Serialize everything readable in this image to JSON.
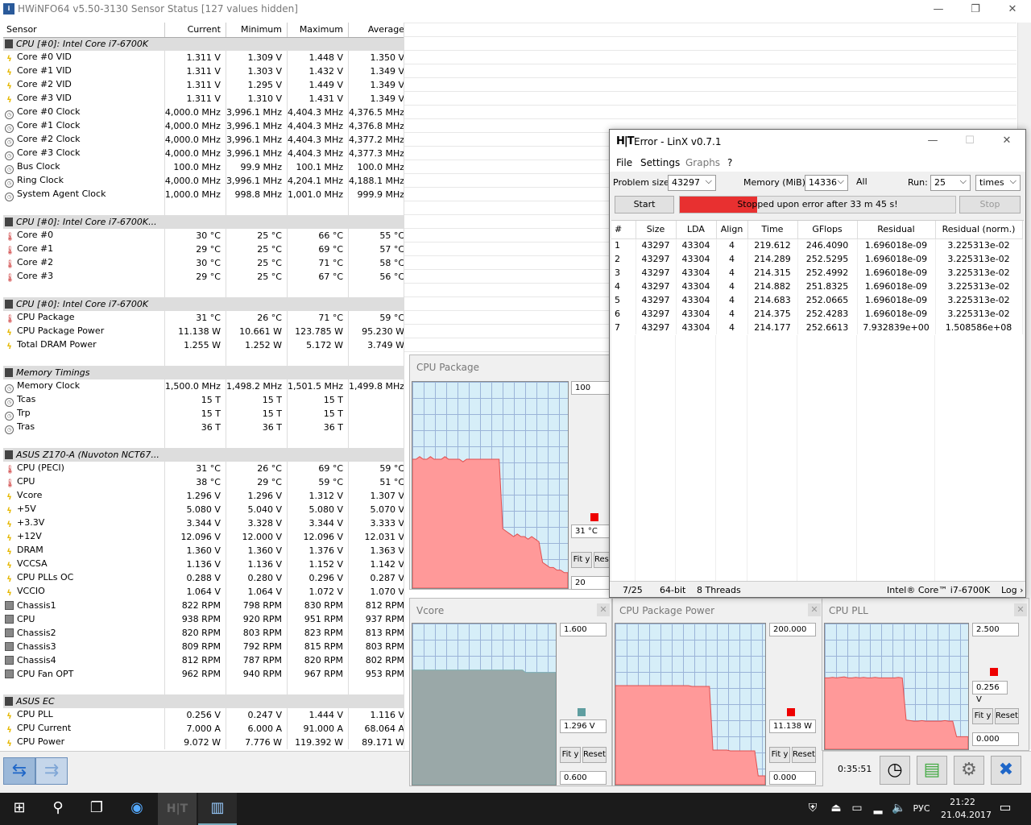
{
  "hwinfo": {
    "title": "HWiNFO64 v5.50-3130 Sensor Status [127 values hidden]",
    "columns": [
      "Sensor",
      "Current",
      "Minimum",
      "Maximum",
      "Average"
    ],
    "rows": [
      {
        "type": "group",
        "name": "CPU [#0]: Intel Core i7-6700K",
        "icon": "chip-icon"
      },
      {
        "icon": "volt",
        "name": "Core #0 VID",
        "cur": "1.311 V",
        "min": "1.309 V",
        "max": "1.448 V",
        "avg": "1.350 V"
      },
      {
        "icon": "volt",
        "name": "Core #1 VID",
        "cur": "1.311 V",
        "min": "1.303 V",
        "max": "1.432 V",
        "avg": "1.349 V"
      },
      {
        "icon": "volt",
        "name": "Core #2 VID",
        "cur": "1.311 V",
        "min": "1.295 V",
        "max": "1.449 V",
        "avg": "1.349 V"
      },
      {
        "icon": "volt",
        "name": "Core #3 VID",
        "cur": "1.311 V",
        "min": "1.310 V",
        "max": "1.431 V",
        "avg": "1.349 V"
      },
      {
        "icon": "clock",
        "name": "Core #0 Clock",
        "cur": "4,000.0 MHz",
        "min": "3,996.1 MHz",
        "max": "4,404.3 MHz",
        "avg": "4,376.5 MHz"
      },
      {
        "icon": "clock",
        "name": "Core #1 Clock",
        "cur": "4,000.0 MHz",
        "min": "3,996.1 MHz",
        "max": "4,404.3 MHz",
        "avg": "4,376.8 MHz"
      },
      {
        "icon": "clock",
        "name": "Core #2 Clock",
        "cur": "4,000.0 MHz",
        "min": "3,996.1 MHz",
        "max": "4,404.3 MHz",
        "avg": "4,377.2 MHz"
      },
      {
        "icon": "clock",
        "name": "Core #3 Clock",
        "cur": "4,000.0 MHz",
        "min": "3,996.1 MHz",
        "max": "4,404.3 MHz",
        "avg": "4,377.3 MHz"
      },
      {
        "icon": "clock",
        "name": "Bus Clock",
        "cur": "100.0 MHz",
        "min": "99.9 MHz",
        "max": "100.1 MHz",
        "avg": "100.0 MHz"
      },
      {
        "icon": "clock",
        "name": "Ring Clock",
        "cur": "4,000.0 MHz",
        "min": "3,996.1 MHz",
        "max": "4,204.1 MHz",
        "avg": "4,188.1 MHz"
      },
      {
        "icon": "clock",
        "name": "System Agent Clock",
        "cur": "1,000.0 MHz",
        "min": "998.8 MHz",
        "max": "1,001.0 MHz",
        "avg": "999.9 MHz"
      },
      {
        "type": "spacer"
      },
      {
        "type": "group",
        "name": "CPU [#0]: Intel Core i7-6700K...",
        "icon": "chip-icon"
      },
      {
        "icon": "temp",
        "name": "Core #0",
        "cur": "30 °C",
        "min": "25 °C",
        "max": "66 °C",
        "avg": "55 °C"
      },
      {
        "icon": "temp",
        "name": "Core #1",
        "cur": "29 °C",
        "min": "25 °C",
        "max": "69 °C",
        "avg": "57 °C"
      },
      {
        "icon": "temp",
        "name": "Core #2",
        "cur": "30 °C",
        "min": "25 °C",
        "max": "71 °C",
        "avg": "58 °C"
      },
      {
        "icon": "temp",
        "name": "Core #3",
        "cur": "29 °C",
        "min": "25 °C",
        "max": "67 °C",
        "avg": "56 °C"
      },
      {
        "type": "spacer"
      },
      {
        "type": "group",
        "name": "CPU [#0]: Intel Core i7-6700K",
        "icon": "chip-icon"
      },
      {
        "icon": "temp",
        "name": "CPU Package",
        "cur": "31 °C",
        "min": "26 °C",
        "max": "71 °C",
        "avg": "59 °C"
      },
      {
        "icon": "power",
        "name": "CPU Package Power",
        "cur": "11.138 W",
        "min": "10.661 W",
        "max": "123.785 W",
        "avg": "95.230 W"
      },
      {
        "icon": "power",
        "name": "Total DRAM Power",
        "cur": "1.255 W",
        "min": "1.252 W",
        "max": "5.172 W",
        "avg": "3.749 W"
      },
      {
        "type": "spacer"
      },
      {
        "type": "group",
        "name": "Memory Timings",
        "icon": "chip-icon"
      },
      {
        "icon": "clock",
        "name": "Memory Clock",
        "cur": "1,500.0 MHz",
        "min": "1,498.2 MHz",
        "max": "1,501.5 MHz",
        "avg": "1,499.8 MHz"
      },
      {
        "icon": "clock",
        "name": "Tcas",
        "cur": "15 T",
        "min": "15 T",
        "max": "15 T",
        "avg": ""
      },
      {
        "icon": "clock",
        "name": "Trp",
        "cur": "15 T",
        "min": "15 T",
        "max": "15 T",
        "avg": ""
      },
      {
        "icon": "clock",
        "name": "Tras",
        "cur": "36 T",
        "min": "36 T",
        "max": "36 T",
        "avg": ""
      },
      {
        "type": "spacer"
      },
      {
        "type": "group",
        "name": "ASUS Z170-A (Nuvoton NCT67...",
        "icon": "chip-icon"
      },
      {
        "icon": "temp",
        "name": "CPU (PECI)",
        "cur": "31 °C",
        "min": "26 °C",
        "max": "69 °C",
        "avg": "59 °C"
      },
      {
        "icon": "temp",
        "name": "CPU",
        "cur": "38 °C",
        "min": "29 °C",
        "max": "59 °C",
        "avg": "51 °C"
      },
      {
        "icon": "volt",
        "name": "Vcore",
        "cur": "1.296 V",
        "min": "1.296 V",
        "max": "1.312 V",
        "avg": "1.307 V"
      },
      {
        "icon": "volt",
        "name": "+5V",
        "cur": "5.080 V",
        "min": "5.040 V",
        "max": "5.080 V",
        "avg": "5.070 V"
      },
      {
        "icon": "volt",
        "name": "+3.3V",
        "cur": "3.344 V",
        "min": "3.328 V",
        "max": "3.344 V",
        "avg": "3.333 V"
      },
      {
        "icon": "volt",
        "name": "+12V",
        "cur": "12.096 V",
        "min": "12.000 V",
        "max": "12.096 V",
        "avg": "12.031 V"
      },
      {
        "icon": "volt",
        "name": "DRAM",
        "cur": "1.360 V",
        "min": "1.360 V",
        "max": "1.376 V",
        "avg": "1.363 V"
      },
      {
        "icon": "volt",
        "name": "VCCSA",
        "cur": "1.136 V",
        "min": "1.136 V",
        "max": "1.152 V",
        "avg": "1.142 V"
      },
      {
        "icon": "volt",
        "name": "CPU PLLs OC",
        "cur": "0.288 V",
        "min": "0.280 V",
        "max": "0.296 V",
        "avg": "0.287 V"
      },
      {
        "icon": "volt",
        "name": "VCCIO",
        "cur": "1.064 V",
        "min": "1.064 V",
        "max": "1.072 V",
        "avg": "1.070 V"
      },
      {
        "icon": "fan",
        "name": "Chassis1",
        "cur": "822 RPM",
        "min": "798 RPM",
        "max": "830 RPM",
        "avg": "812 RPM"
      },
      {
        "icon": "fan",
        "name": "CPU",
        "cur": "938 RPM",
        "min": "920 RPM",
        "max": "951 RPM",
        "avg": "937 RPM"
      },
      {
        "icon": "fan",
        "name": "Chassis2",
        "cur": "820 RPM",
        "min": "803 RPM",
        "max": "823 RPM",
        "avg": "813 RPM"
      },
      {
        "icon": "fan",
        "name": "Chassis3",
        "cur": "809 RPM",
        "min": "792 RPM",
        "max": "815 RPM",
        "avg": "803 RPM"
      },
      {
        "icon": "fan",
        "name": "Chassis4",
        "cur": "812 RPM",
        "min": "787 RPM",
        "max": "820 RPM",
        "avg": "802 RPM"
      },
      {
        "icon": "fan",
        "name": "CPU Fan OPT",
        "cur": "962 RPM",
        "min": "940 RPM",
        "max": "967 RPM",
        "avg": "953 RPM"
      },
      {
        "type": "spacer"
      },
      {
        "type": "group",
        "name": "ASUS EC",
        "icon": "chip-icon"
      },
      {
        "icon": "volt",
        "name": "CPU PLL",
        "cur": "0.256 V",
        "min": "0.247 V",
        "max": "1.444 V",
        "avg": "1.116 V"
      },
      {
        "icon": "volt",
        "name": "CPU Current",
        "cur": "7.000 A",
        "min": "6.000 A",
        "max": "91.000 A",
        "avg": "68.064 A"
      },
      {
        "icon": "power",
        "name": "CPU Power",
        "cur": "9.072 W",
        "min": "7.776 W",
        "max": "119.392 W",
        "avg": "89.171 W"
      }
    ],
    "timer": "0:35:51"
  },
  "graphs": {
    "cpu_package": {
      "title": "CPU Package",
      "top": "100",
      "current": "31 °C",
      "bottom": "20",
      "fit": "Fit y",
      "reset": "Reset",
      "color": "#ff9999",
      "series": [
        70,
        70,
        71,
        70,
        70,
        71,
        70,
        70,
        70,
        71,
        70,
        70,
        70,
        70,
        69,
        70,
        70,
        70,
        70,
        70,
        70,
        70,
        70,
        70,
        70,
        43,
        42,
        41,
        40,
        41,
        40,
        40,
        39,
        40,
        39,
        38,
        30,
        29,
        28,
        28,
        27,
        27,
        26,
        26
      ]
    },
    "vcore": {
      "title": "Vcore",
      "top": "1.600",
      "current": "1.296 V",
      "bottom": "0.600",
      "fit": "Fit y",
      "reset": "Reset",
      "color": "#5f9ea0",
      "series": [
        1.312,
        1.312,
        1.312,
        1.312,
        1.312,
        1.312,
        1.312,
        1.312,
        1.312,
        1.312,
        1.312,
        1.312,
        1.312,
        1.312,
        1.312,
        1.312,
        1.312,
        1.312,
        1.312,
        1.312,
        1.312,
        1.312,
        1.312,
        1.312,
        1.312,
        1.312,
        1.312,
        1.312,
        1.312,
        1.312,
        1.312,
        1.312,
        1.312,
        1.312,
        1.296,
        1.296,
        1.296,
        1.296,
        1.296,
        1.296,
        1.296,
        1.296,
        1.296,
        1.296
      ]
    },
    "cpu_package_power": {
      "title": "CPU Package Power",
      "top": "200.000",
      "current": "11.138 W",
      "bottom": "0.000",
      "fit": "Fit y",
      "reset": "Reset",
      "color": "#ff9999",
      "series": [
        123,
        123,
        123,
        123,
        123,
        123,
        123,
        123,
        123,
        123,
        123,
        123,
        123,
        123,
        123,
        123,
        123,
        123,
        123,
        123,
        123,
        123,
        122,
        122,
        122,
        122,
        122,
        122,
        43,
        43,
        43,
        43,
        43,
        42,
        42,
        42,
        42,
        42,
        42,
        42,
        42,
        11,
        11,
        11
      ]
    },
    "cpu_pll": {
      "title": "CPU PLL",
      "top": "2.500",
      "current": "0.256 V",
      "bottom": "0.000",
      "fit": "Fit y",
      "reset": "Reset",
      "color": "#ff9999",
      "series": [
        1.42,
        1.42,
        1.43,
        1.42,
        1.43,
        1.44,
        1.42,
        1.42,
        1.43,
        1.42,
        1.43,
        1.42,
        1.42,
        1.43,
        1.42,
        1.42,
        1.42,
        1.42,
        1.42,
        1.43,
        1.42,
        0.58,
        0.57,
        0.56,
        0.56,
        0.57,
        0.56,
        0.56,
        0.56,
        0.56,
        0.56,
        0.57,
        0.56,
        0.56,
        0.25,
        0.25,
        0.25,
        0.25
      ]
    }
  },
  "linx": {
    "title": "Error - LinX v0.7.1",
    "logo": "LinX",
    "menu": [
      "File",
      "Settings",
      "Graphs",
      "?"
    ],
    "problem_size_label": "Problem size:",
    "problem_size": "43297",
    "memory_label": "Memory (MiB):",
    "memory": "14336",
    "all_label": "All",
    "run_label": "Run:",
    "run": "25",
    "run_unit": "times",
    "start": "Start",
    "stop": "Stop",
    "progress_text": "Stopped upon error after 33 m 45 s!",
    "progress": 0.28,
    "columns": [
      "#",
      "Size",
      "LDA",
      "Align",
      "Time",
      "GFlops",
      "Residual",
      "Residual (norm.)"
    ],
    "results": [
      [
        "1",
        "43297",
        "43304",
        "4",
        "219.612",
        "246.4090",
        "1.696018e-09",
        "3.225313e-02"
      ],
      [
        "2",
        "43297",
        "43304",
        "4",
        "214.289",
        "252.5295",
        "1.696018e-09",
        "3.225313e-02"
      ],
      [
        "3",
        "43297",
        "43304",
        "4",
        "214.315",
        "252.4992",
        "1.696018e-09",
        "3.225313e-02"
      ],
      [
        "4",
        "43297",
        "43304",
        "4",
        "214.882",
        "251.8325",
        "1.696018e-09",
        "3.225313e-02"
      ],
      [
        "5",
        "43297",
        "43304",
        "4",
        "214.683",
        "252.0665",
        "1.696018e-09",
        "3.225313e-02"
      ],
      [
        "6",
        "43297",
        "43304",
        "4",
        "214.375",
        "252.4283",
        "1.696018e-09",
        "3.225313e-02"
      ],
      [
        "7",
        "43297",
        "43304",
        "4",
        "214.177",
        "252.6613",
        "7.932839e+00",
        "1.508586e+08"
      ]
    ],
    "status": {
      "runs": "7/25",
      "arch": "64-bit",
      "threads": "8 Threads",
      "cpu": "Intel® Core™ i7-6700K",
      "log": "Log ›"
    }
  },
  "taskbar": {
    "time": "21:22",
    "date": "21.04.2017",
    "lang": "РУС"
  }
}
